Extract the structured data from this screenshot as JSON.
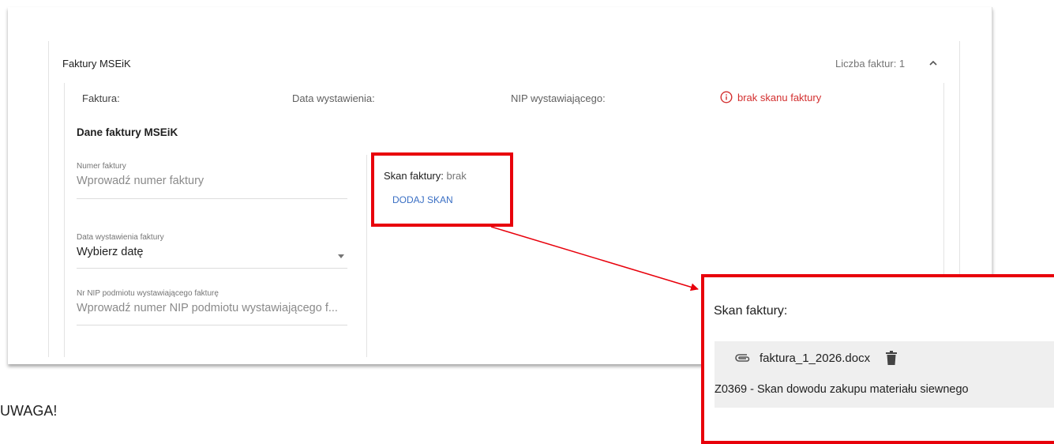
{
  "panel": {
    "title": "Faktury MSEiK",
    "count_label": "Liczba faktur: 1"
  },
  "invoice_header": {
    "faktura": "Faktura:",
    "data_wystawienia": "Data wystawienia:",
    "nip_wystawiajacego": "NIP wystawiającego:",
    "warning": "brak skanu faktury"
  },
  "section": {
    "title": "Dane faktury MSEiK"
  },
  "fields": {
    "numer": {
      "label": "Numer faktury",
      "placeholder": "Wprowadź numer faktury"
    },
    "data": {
      "label": "Data wystawienia faktury",
      "value": "Wybierz datę"
    },
    "nip": {
      "label": "Nr NIP podmiotu wystawiającego fakturę",
      "placeholder": "Wprowadź numer NIP podmiotu wystawiającego f..."
    }
  },
  "scan": {
    "label": "Skan faktury:",
    "value": "brak",
    "add_button": "DODAJ SKAN"
  },
  "zoom": {
    "title": "Skan faktury:",
    "file_name": "faktura_1_2026.docx",
    "description": "Z0369 - Skan dowodu zakupu materiału siewnego"
  },
  "note": "UWAGA!",
  "colors": {
    "highlight": "#e8000b",
    "warning": "#d32f2f",
    "link": "#3a6fc4"
  },
  "icons": [
    "chevron-up-icon",
    "info-icon",
    "dropdown-arrow-icon",
    "paperclip-icon",
    "trash-icon"
  ]
}
